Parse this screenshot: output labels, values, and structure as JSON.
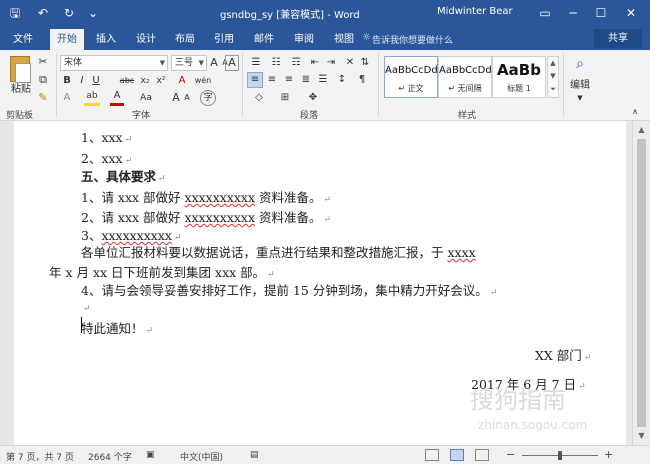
{
  "titlebar": {
    "doc_title": "gsndbg_sy [兼容模式] - Word",
    "user": "Midwinter Bear",
    "save_icon": "🖫",
    "undo_icon": "↶",
    "redo_icon": "↻",
    "customize_icon": "⌄",
    "ribbon_options_icon": "▭",
    "minimize_icon": "─",
    "maximize_icon": "☐",
    "close_icon": "✕"
  },
  "tabs": [
    "文件",
    "开始",
    "插入",
    "设计",
    "布局",
    "引用",
    "邮件",
    "审阅",
    "视图"
  ],
  "tell_me": "告诉我你想要做什么",
  "share": "共享",
  "ribbon": {
    "clipboard": {
      "paste": "粘贴",
      "label": "剪贴板"
    },
    "font": {
      "name": "宋体",
      "size": "三号",
      "grow": "A",
      "shrink": "A",
      "aa": "Aa",
      "clear": "A",
      "wen": "wén",
      "A_box": "A",
      "bold": "B",
      "italic": "I",
      "underline": "U",
      "strike": "abc",
      "sub": "x₂",
      "sup": "x²",
      "effects": "A",
      "highlight": "ab",
      "color": "A",
      "case": "Aa",
      "grow2": "A",
      "shrink2": "A",
      "circle": "字",
      "label": "字体"
    },
    "paragraph": {
      "label": "段落"
    },
    "styles": {
      "items": [
        {
          "sample": "AaBbCcDd",
          "name": "↵ 正文"
        },
        {
          "sample": "AaBbCcDd",
          "name": "↵ 无间隔"
        },
        {
          "sample": "AaBb",
          "name": "标题 1"
        }
      ],
      "label": "样式"
    },
    "editing": {
      "label": "编辑"
    }
  },
  "document": {
    "lines": [
      {
        "text": "1、xxx",
        "mark": "↵"
      },
      {
        "text": "2、xxx",
        "mark": "↵"
      },
      {
        "text": "五、具体要求",
        "mark": "↵"
      },
      {
        "pre": "1、请 xxx 部做好 ",
        "squig": "xxxxxxxxxx",
        "post": " 资料准备。",
        "mark": "↵"
      },
      {
        "pre": "2、请 xxx 部做好 ",
        "squig": "xxxxxxxxxx",
        "post": " 资料准备。",
        "mark": "↵"
      },
      {
        "pre": "3、",
        "squig": "xxxxxxxxxx",
        "post": "",
        "mark": "↵"
      },
      {
        "pre": "各单位汇报材料要以数据说话，重点进行结果和整改措施汇报，于 ",
        "squig": "xxxx",
        "post": "",
        "mark": ""
      },
      {
        "text": "年 x 月 xx 日下班前发到集团 xxx 部。",
        "mark": "↵"
      },
      {
        "text": "4、请与会领导妥善安排好工作，提前 15 分钟到场，集中精力开好会议。",
        "mark": "↵"
      },
      {
        "text": "",
        "mark": "↵"
      },
      {
        "text": "特此通知！",
        "mark": "↵"
      },
      {
        "text": "XX 部门",
        "mark": "↵"
      },
      {
        "text": "2017 年 6 月 7 日",
        "mark": "↵"
      }
    ]
  },
  "status": {
    "page": "第 7 页，共 7 页",
    "words": "2664 个字",
    "lang": "中文(中国)"
  },
  "watermark": {
    "text1": "搜狗指南",
    "text2": "zhinan.sogou.com"
  },
  "colors": {
    "accent": "#2b579a",
    "squiggle": "#e03030"
  }
}
